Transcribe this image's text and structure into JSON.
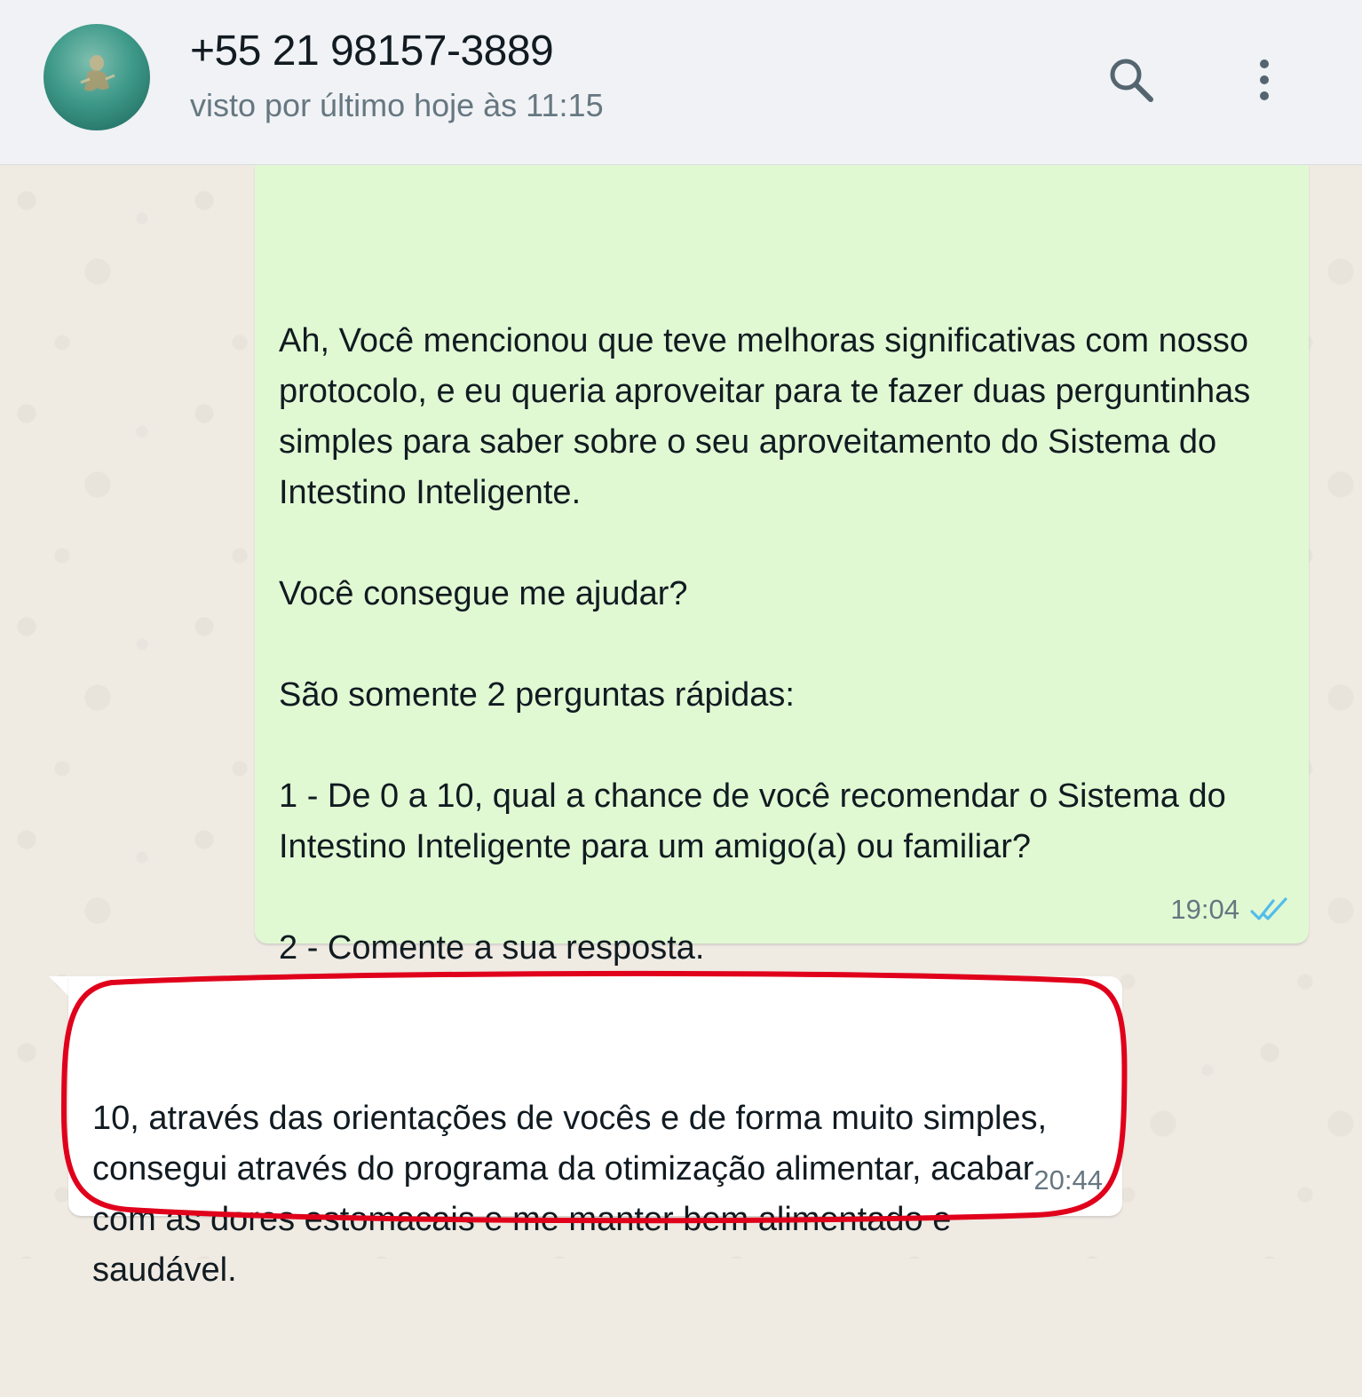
{
  "header": {
    "contact_name": "+55 21 98157-3889",
    "status": "visto por último hoje às 11:15",
    "icons": [
      "avatar",
      "search-icon",
      "more-options-icon"
    ]
  },
  "messages": [
    {
      "direction": "outgoing",
      "text": "Ah, Você mencionou que teve melhoras significativas com nosso protocolo, e eu queria aproveitar para te fazer duas perguntinhas simples para saber sobre o seu aproveitamento do Sistema do Intestino Inteligente.\n\nVocê consegue me ajudar?\n\nSão somente 2 perguntas rápidas:\n\n1 - De 0 a 10, qual a chance de você recomendar o Sistema do Intestino Inteligente para um amigo(a) ou familiar?\n\n2 - Comente a sua resposta.",
      "time": "19:04",
      "status_icon": "double-check-read-icon"
    },
    {
      "direction": "incoming",
      "text": "10, através das orientações de vocês e de forma muito simples, consegui através do programa da otimização alimentar, acabar com as dores estomacais e me manter bem alimentado e saudável.",
      "time": "20:44"
    }
  ],
  "colors": {
    "header_bg": "#f0f2f5",
    "chat_bg": "#efeae2",
    "outgoing_bubble": "#e1f9d3",
    "incoming_bubble": "#ffffff",
    "read_ticks": "#53bdeb",
    "highlight": "#e0001b"
  }
}
